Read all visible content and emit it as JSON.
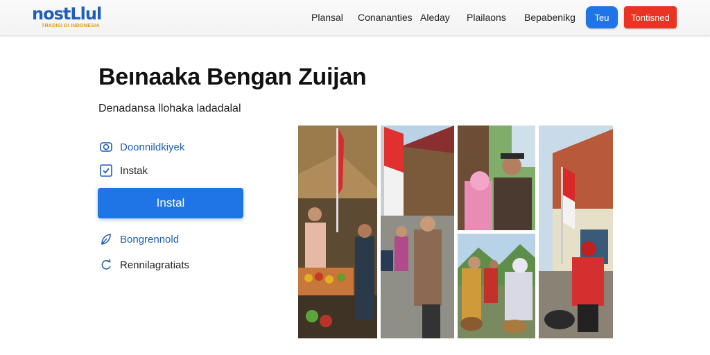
{
  "header": {
    "logo_text": "nostLlul",
    "logo_tagline": "TRADISI DI INDONESIA",
    "nav": [
      "Plansal",
      "Conananties",
      "Aleday",
      "Plailaons",
      "Bepabenikg"
    ],
    "pill_button": "Teu",
    "red_button": "Tontisned"
  },
  "main": {
    "title": "Beınaaka Bengan Zuijan",
    "subtitle": "Denadansa llohaka ladadalal",
    "features": [
      {
        "label": "Doonnildkiyek",
        "icon": "camera-icon"
      },
      {
        "label": "Instak",
        "icon": "checkbox-icon"
      }
    ],
    "install_label": "Instal",
    "links": [
      {
        "label": "Bongrennold",
        "icon": "leaf-icon"
      },
      {
        "label": "Rennilagratiats",
        "icon": "refresh-icon"
      }
    ]
  },
  "colors": {
    "accent": "#1f75e6",
    "danger": "#ea3323",
    "link": "#1f5fb8",
    "logo_tag": "#e2901b"
  }
}
